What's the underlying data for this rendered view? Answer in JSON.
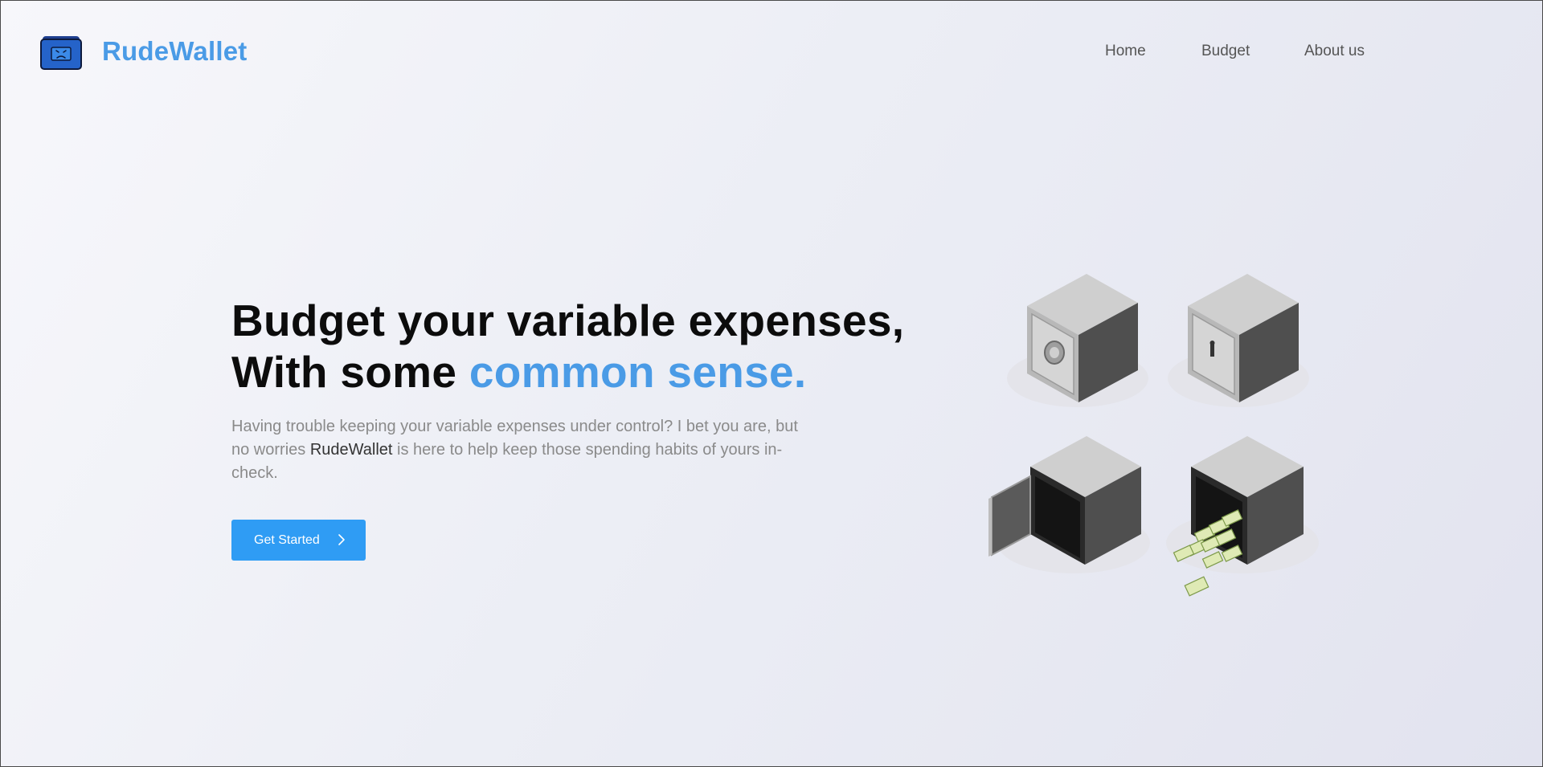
{
  "brand": {
    "name": "RudeWallet",
    "logo_icon": "sad-wallet-icon"
  },
  "nav": {
    "items": [
      {
        "label": "Home"
      },
      {
        "label": "Budget"
      },
      {
        "label": "About us"
      }
    ]
  },
  "hero": {
    "headline_line1": "Budget your variable expenses,",
    "headline_line2_prefix": "With some ",
    "headline_line2_accent": "common sense.",
    "description_part1": "Having trouble keeping your variable expenses under control?  I bet you are, but no worries ",
    "description_brand": "RudeWallet",
    "description_part2": " is here to help keep those spending habits of yours in-check.",
    "cta_label": "Get Started",
    "cta_icon": "chevron-right-icon"
  },
  "colors": {
    "accent": "#4a9be6",
    "button": "#2f9cf4",
    "headline": "#0c0c0c",
    "body_text": "#8a8a8a"
  },
  "illustration": {
    "name": "safes-illustration",
    "items": [
      "dial-safe",
      "key-safe",
      "open-empty-safe",
      "open-money-safe"
    ]
  }
}
